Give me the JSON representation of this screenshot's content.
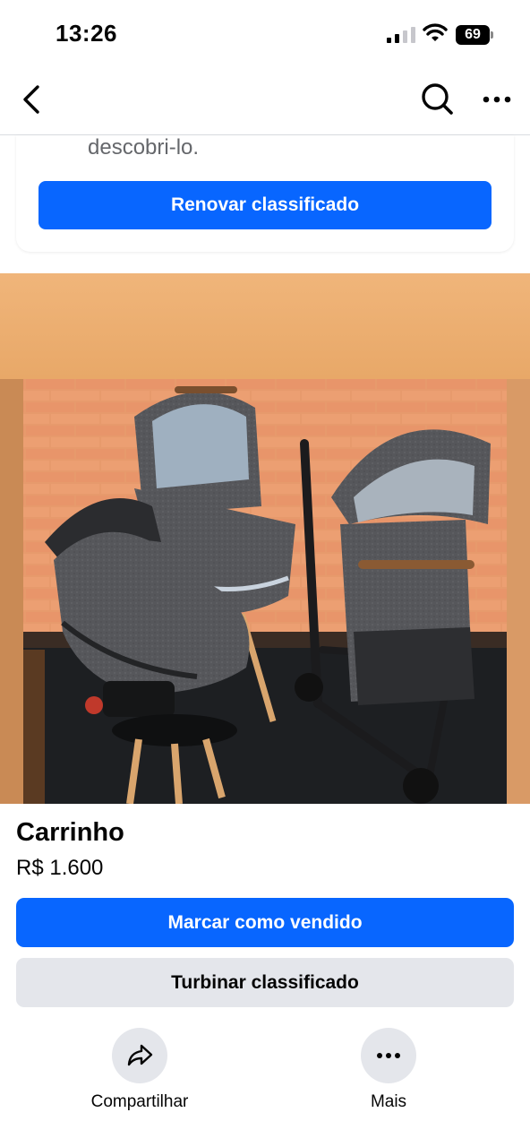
{
  "status_bar": {
    "time": "13:26",
    "battery": "69",
    "icons": [
      "signal-icon",
      "wifi-icon",
      "battery-icon"
    ]
  },
  "nav": {
    "icons": [
      "back-chevron-icon",
      "search-icon",
      "more-horizontal-icon"
    ]
  },
  "renew_card": {
    "text": "descobri-lo.",
    "button_label": "Renovar classificado"
  },
  "listing": {
    "photo_icon": "stroller-travel-system-photo",
    "title": "Carrinho",
    "price": "R$ 1.600",
    "primary_button": "Marcar como vendido",
    "secondary_button": "Turbinar classificado"
  },
  "actions": [
    {
      "label": "Compartilhar",
      "icon": "share-arrow-icon"
    },
    {
      "label": "Mais",
      "icon": "more-horizontal-icon"
    }
  ],
  "colors": {
    "accent": "#0866ff",
    "secondary_button": "#e4e6eb",
    "muted_text": "#65676b"
  }
}
